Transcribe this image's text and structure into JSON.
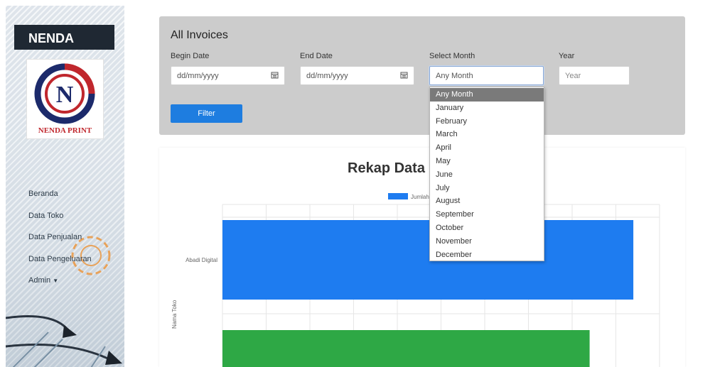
{
  "sidebar": {
    "brand": "NENDA",
    "logo_text": "NENDA PRINT",
    "nav": [
      {
        "label": "Beranda"
      },
      {
        "label": "Data Toko"
      },
      {
        "label": "Data Penjualan"
      },
      {
        "label": "Data Pengeluaran"
      },
      {
        "label": "Admin"
      }
    ]
  },
  "filter": {
    "title": "All Invoices",
    "begin_date_label": "Begin Date",
    "begin_date_value": "dd/mm/yyyy",
    "end_date_label": "End Date",
    "end_date_value": "dd/mm/yyyy",
    "month_label": "Select Month",
    "month_value": "Any Month",
    "year_label": "Year",
    "year_placeholder": "Year",
    "button": "Filter"
  },
  "month_options": [
    "Any Month",
    "January",
    "February",
    "March",
    "April",
    "May",
    "June",
    "July",
    "August",
    "September",
    "October",
    "November",
    "December"
  ],
  "chart": {
    "title": "Rekap Data",
    "legend_label": "Jumlah",
    "ylabel": "Nama Toko",
    "colors": {
      "bar1": "#1e7cf0",
      "bar2": "#2ea845",
      "legend": "#1e7cf0"
    }
  },
  "chart_data": {
    "type": "bar",
    "orientation": "horizontal",
    "categories": [
      "Abadi Digital",
      ""
    ],
    "series": [
      {
        "name": "Jumlah",
        "values": [
          94,
          84
        ]
      }
    ],
    "ylabel": "Nama Toko",
    "xlim": [
      0,
      100
    ],
    "grid": true,
    "legend": "top"
  }
}
